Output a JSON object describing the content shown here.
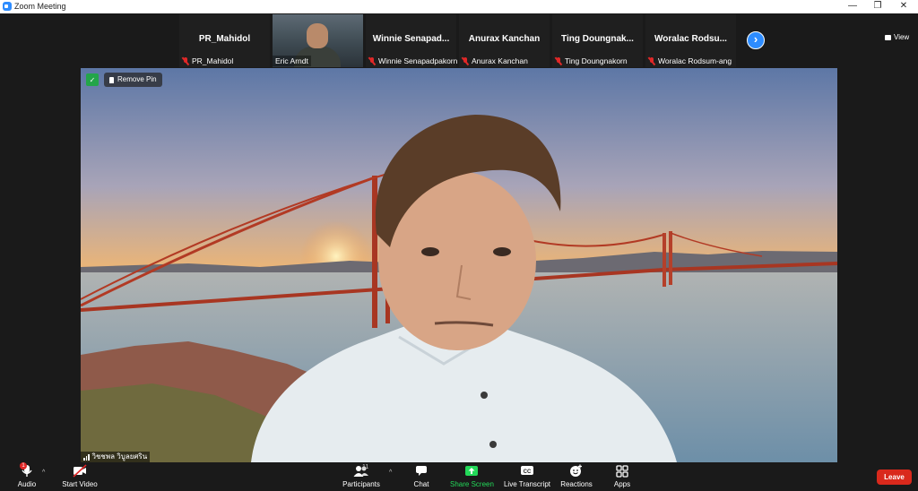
{
  "window": {
    "title": "Zoom Meeting",
    "minimize": "—",
    "restore": "❐",
    "close": "✕"
  },
  "strip": {
    "participants": [
      {
        "display": "PR_Mahidol",
        "label": "PR_Mahidol",
        "muted": true
      },
      {
        "display": "",
        "label": "Eric Arndt",
        "muted": false,
        "video": true
      },
      {
        "display": "Winnie  Senapad...",
        "label": "Winnie Senapadpakorn",
        "muted": true
      },
      {
        "display": "Anurax Kanchan",
        "label": "Anurax Kanchan",
        "muted": true
      },
      {
        "display": "Ting  Doungnak...",
        "label": "Ting Doungnakorn",
        "muted": true
      },
      {
        "display": "Woralac  Rodsu...",
        "label": "Woralac Rodsum-ang",
        "muted": true
      }
    ],
    "next_icon": "›",
    "view_label": "View"
  },
  "stage": {
    "remove_pin_label": "Remove Pin",
    "speaker_name": "วิชชพล วิบูลยศริน"
  },
  "toolbar": {
    "audio_label": "Audio",
    "audio_badge": "1",
    "start_video_label": "Start Video",
    "participants_label": "Participants",
    "participants_count": "11",
    "chat_label": "Chat",
    "share_screen_label": "Share Screen",
    "live_transcript_label": "Live Transcript",
    "reactions_label": "Reactions",
    "apps_label": "Apps",
    "leave_label": "Leave",
    "caret": "^"
  },
  "colors": {
    "accent": "#2d8cff",
    "share_green": "#23d959",
    "leave_red": "#d9291c",
    "muted_red": "#e02828"
  }
}
